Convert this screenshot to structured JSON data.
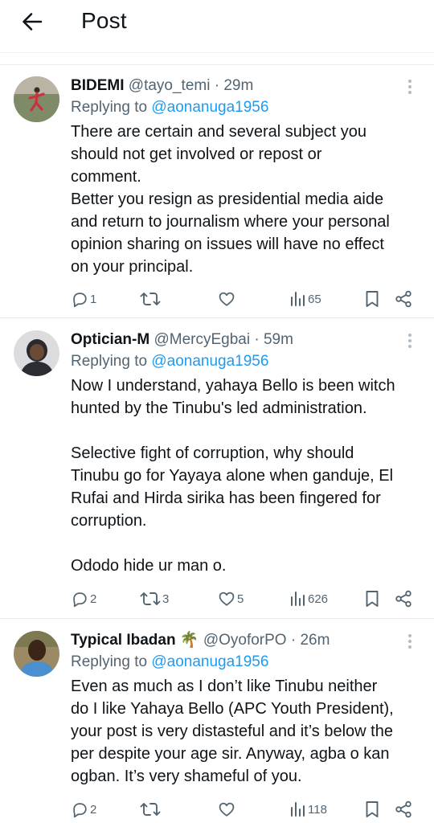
{
  "header": {
    "title": "Post"
  },
  "replies": [
    {
      "name": "BIDEMI",
      "handle": "@tayo_temi",
      "time": "29m",
      "replying_label": "Replying to",
      "replying_handle": "@aonanuga1956",
      "lines": [
        "There are certain and several subject you",
        "should not get involved or repost or",
        "comment.",
        "Better you resign as presidential media aide",
        "and return to journalism where your personal",
        "opinion sharing on issues will have no effect",
        "on your principal."
      ],
      "replies": "1",
      "reposts": "",
      "likes": "",
      "views": "65"
    },
    {
      "name": "Optician-M",
      "handle": "@MercyEgbai",
      "time": "59m",
      "replying_label": "Replying to",
      "replying_handle": "@aonanuga1956",
      "lines": [
        "Now I understand, yahaya Bello is been witch",
        "hunted by the Tinubu's led administration.",
        "",
        "Selective fight of corruption, why should",
        "Tinubu go for Yayaya alone when ganduje, El",
        "Rufai and Hirda sirika has been fingered for",
        "corruption.",
        "",
        "Ododo hide ur man o."
      ],
      "replies": "2",
      "reposts": "3",
      "likes": "5",
      "views": "626"
    },
    {
      "name": "Typical Ibadan",
      "name_emoji": "🌴",
      "handle": "@OyoforPO",
      "time": "26m",
      "replying_label": "Replying to",
      "replying_handle": "@aonanuga1956",
      "lines": [
        "Even as much as I don’t like Tinubu neither",
        "do I like Yahaya Bello (APC Youth President),",
        "your post is very distasteful and it’s below the",
        "per despite your age sir. Anyway, agba o kan",
        "ogban. It’s very shameful of you."
      ],
      "replies": "2",
      "reposts": "",
      "likes": "",
      "views": "118"
    }
  ],
  "colors": {
    "link": "#1d9bf0",
    "muted": "#536471",
    "text": "#0f1419"
  },
  "icons": [
    "back-arrow-icon",
    "more-icon",
    "reply-icon",
    "repost-icon",
    "like-icon",
    "views-icon",
    "bookmark-icon",
    "share-icon"
  ]
}
